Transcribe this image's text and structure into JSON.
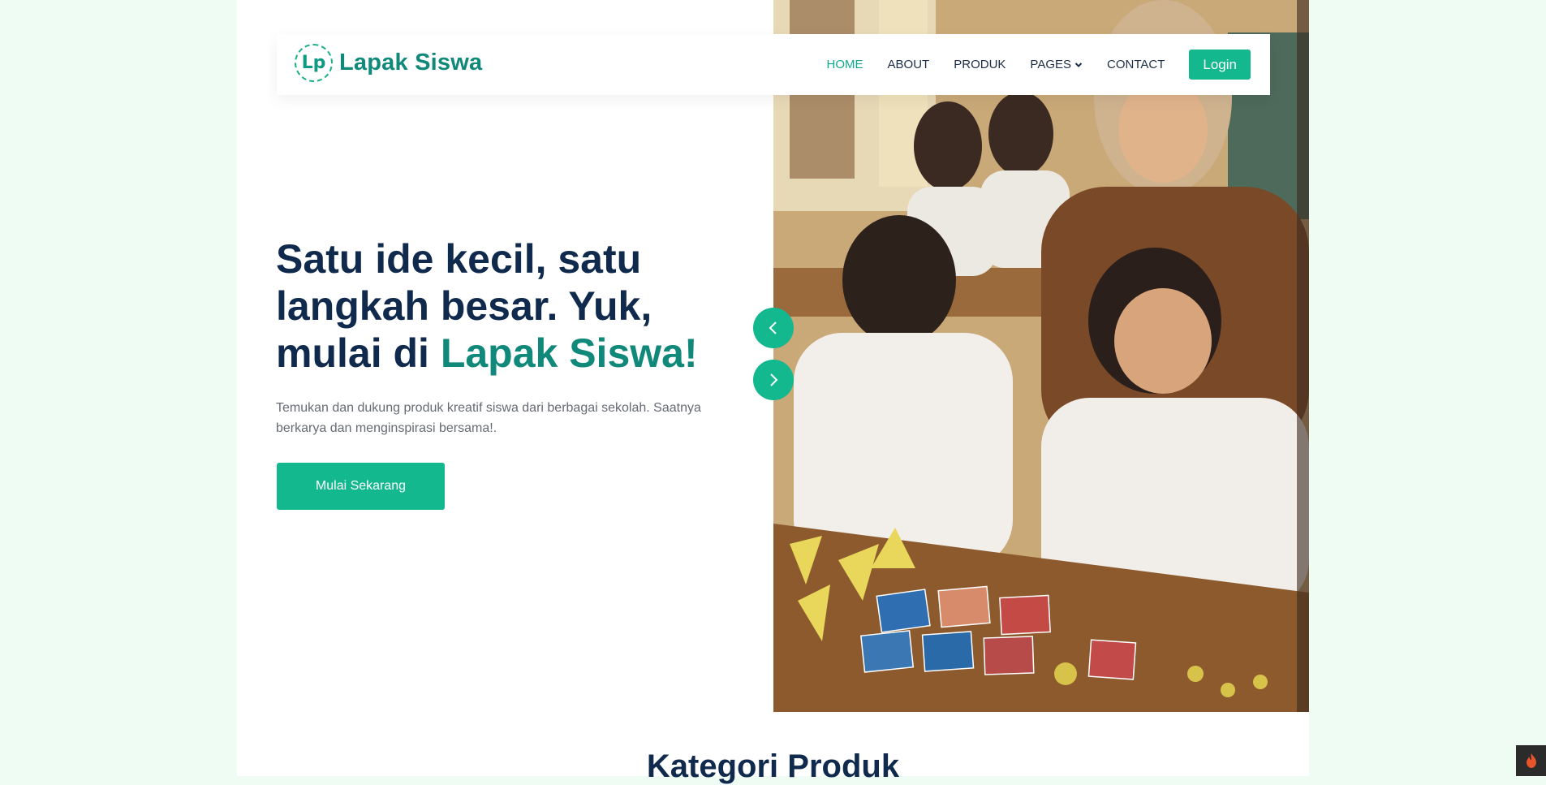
{
  "brand": {
    "logo_text": "Lp",
    "name": "Lapak Siswa"
  },
  "nav": {
    "items": [
      {
        "label": "HOME",
        "active": true
      },
      {
        "label": "ABOUT"
      },
      {
        "label": "PRODUK"
      },
      {
        "label": "PAGES"
      },
      {
        "label": "CONTACT"
      }
    ],
    "login_label": "Login"
  },
  "hero": {
    "title_main": "Satu ide kecil, satu langkah besar. Yuk, mulai di ",
    "title_accent": "Lapak Siswa!",
    "subtitle": "Temukan dan dukung produk kreatif siswa dari berbagai sekolah. Saatnya berkarya dan menginspirasi bersama!.",
    "cta_label": "Mulai Sekarang"
  },
  "section": {
    "title": "Kategori Produk"
  },
  "colors": {
    "primary": "#13b88f",
    "brand": "#10897a",
    "heading": "#102a4d"
  },
  "icons": [
    "chevron-left-icon",
    "chevron-right-icon",
    "chevron-down-icon",
    "flame-icon"
  ]
}
